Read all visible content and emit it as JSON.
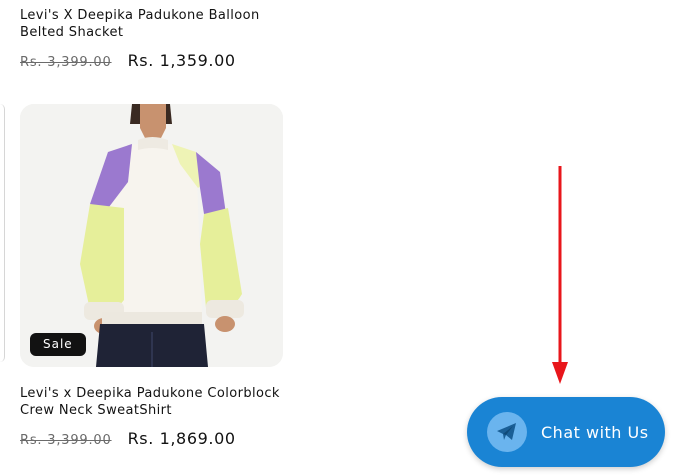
{
  "products": [
    {
      "title": "Levi's X Deepika Padukone Balloon Belted Shacket",
      "old_price": "Rs. 3,399.00",
      "new_price": "Rs. 1,359.00"
    },
    {
      "title": "Levi's x Deepika Padukone Colorblock Crew Neck SweatShirt",
      "old_price": "Rs. 3,399.00",
      "new_price": "Rs. 1,869.00",
      "badge": "Sale"
    }
  ],
  "chat_widget": {
    "label": "Chat with Us",
    "icon": "telegram-icon",
    "color": "#1a84d4"
  },
  "annotation": {
    "arrow_color": "#e8161b"
  }
}
